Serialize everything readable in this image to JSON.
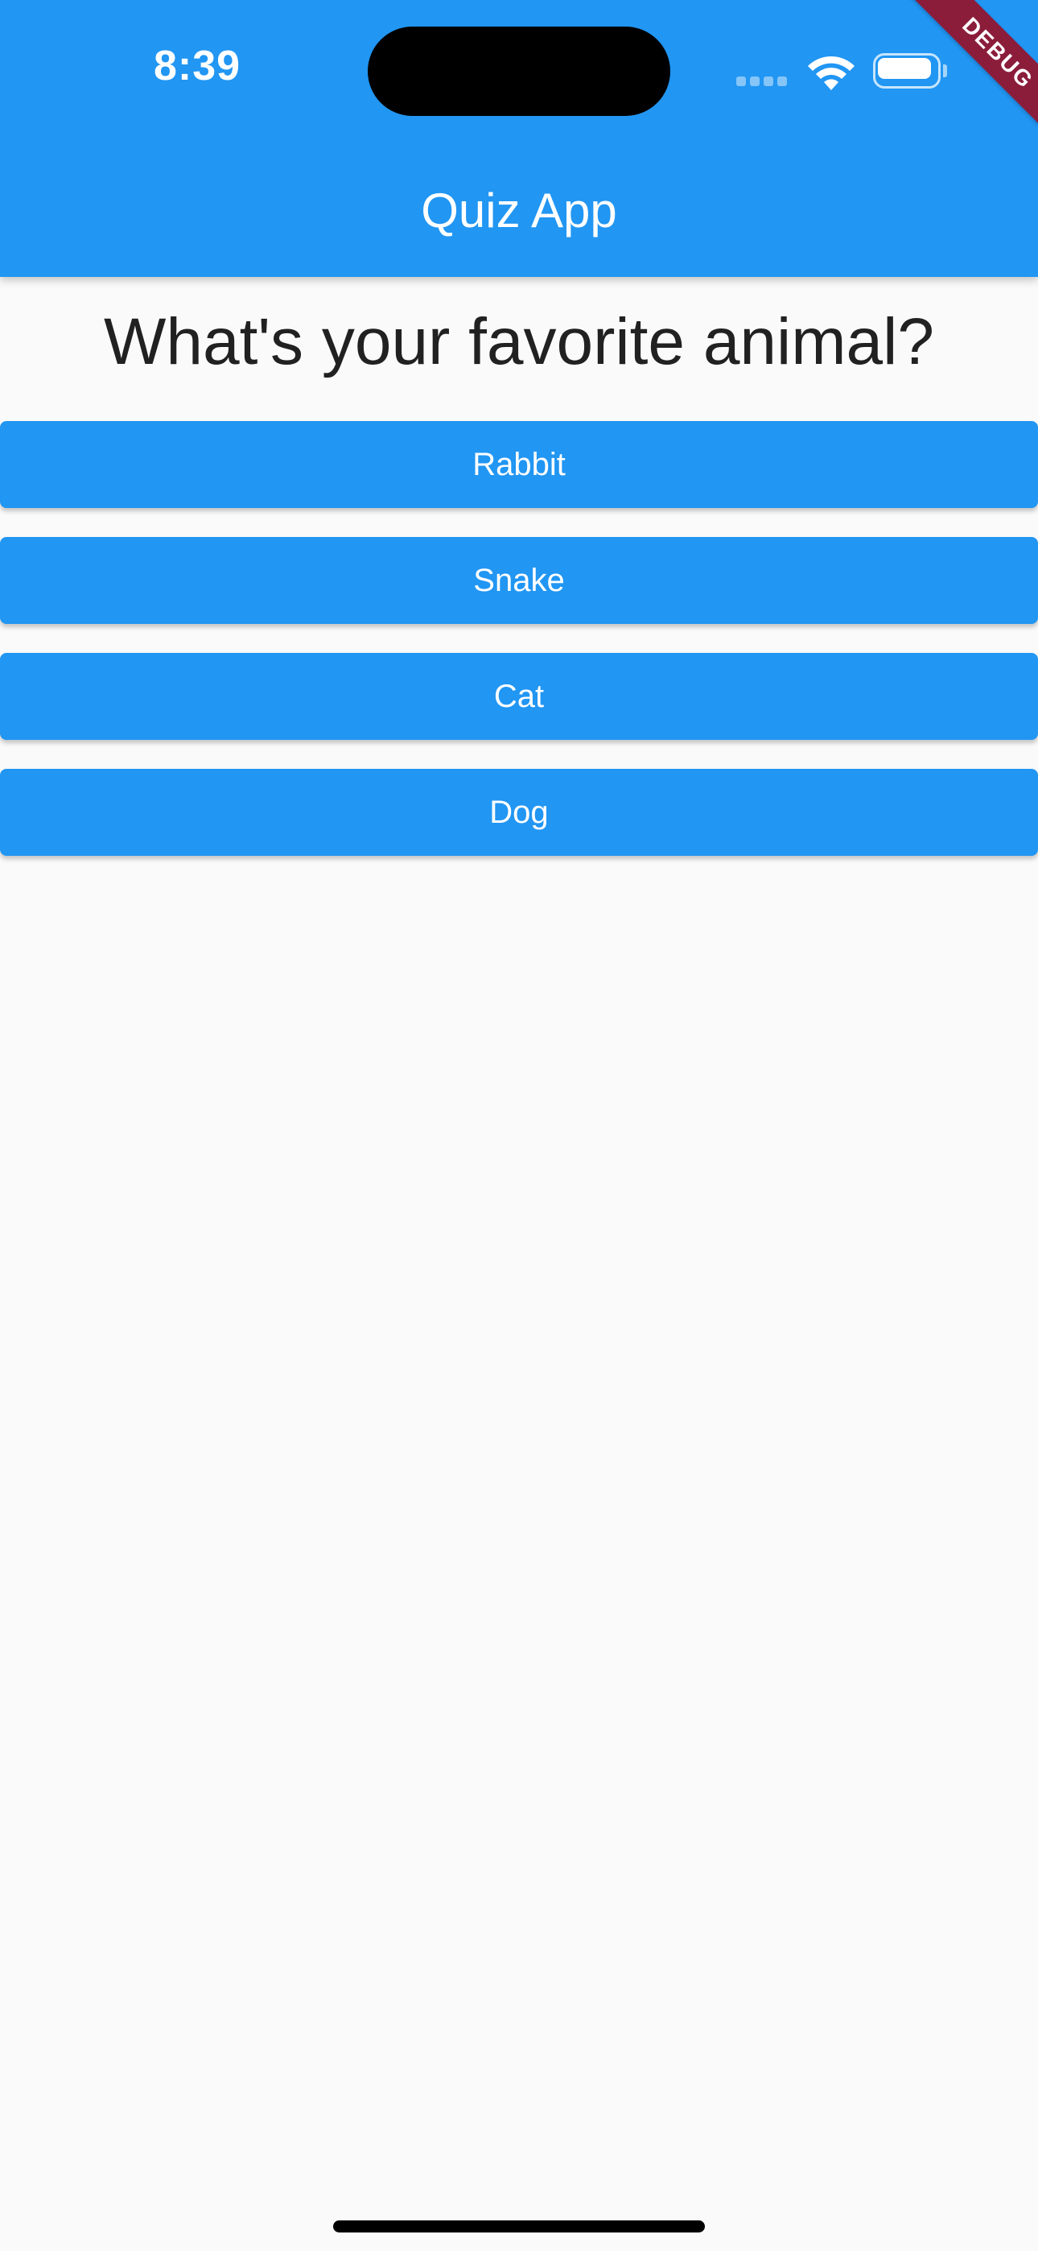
{
  "status_bar": {
    "time": "8:39",
    "signal_icon": "cellular-signal-icon",
    "wifi_icon": "wifi-icon",
    "battery_icon": "battery-icon"
  },
  "app_bar": {
    "title": "Quiz App",
    "color": "#2196f3"
  },
  "debug_banner": {
    "label": "DEBUG",
    "color": "#8b1d3b"
  },
  "quiz": {
    "question": "What's your favorite animal?",
    "answers": [
      {
        "label": "Rabbit"
      },
      {
        "label": "Snake"
      },
      {
        "label": "Cat"
      },
      {
        "label": "Dog"
      }
    ]
  }
}
